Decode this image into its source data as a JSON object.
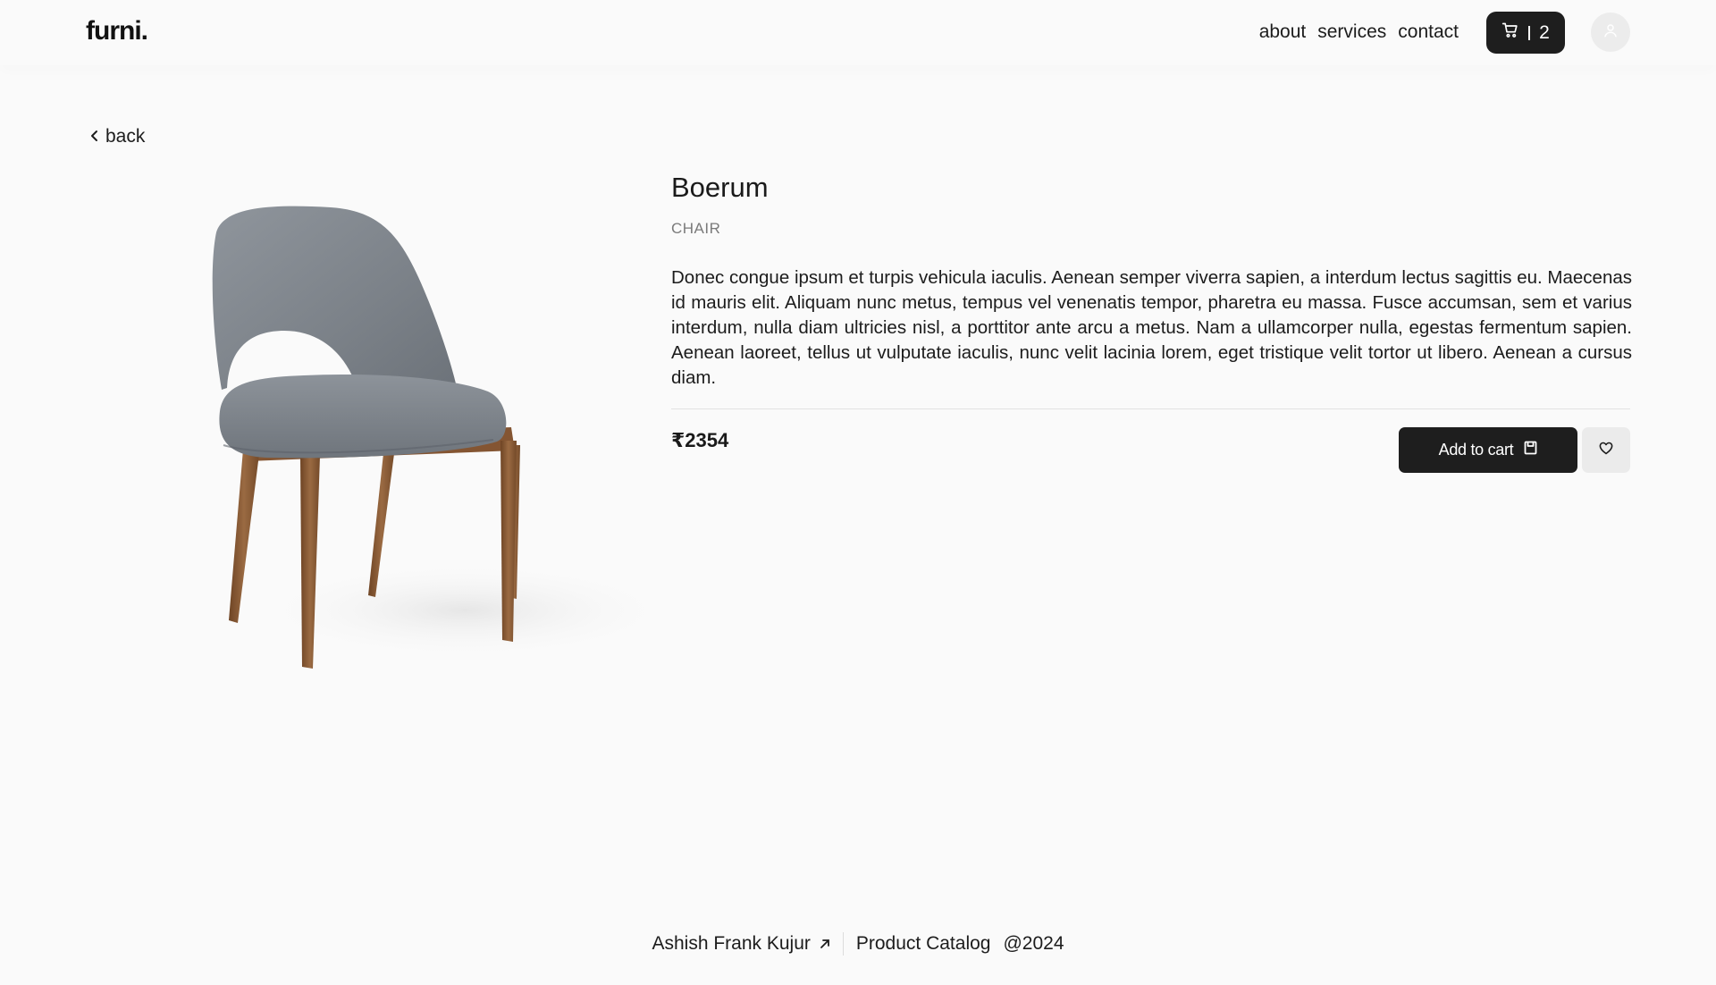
{
  "header": {
    "logo": "furni.",
    "nav": [
      "about",
      "services",
      "contact"
    ],
    "cart_count": "2"
  },
  "back_label": "back",
  "product": {
    "name": "Boerum",
    "category": "CHAIR",
    "description": "Donec congue ipsum et turpis vehicula iaculis. Aenean semper viverra sapien, a interdum lectus sagittis eu. Maecenas id mauris elit. Aliquam nunc metus, tempus vel venenatis tempor, pharetra eu massa. Fusce accumsan, sem et varius interdum, nulla diam ultricies nisl, a porttitor ante arcu a metus. Nam a ullamcorper nulla, egestas fermentum sapien. Aenean laoreet, tellus ut vulputate iaculis, nunc velit lacinia lorem, eget tristique velit tortor ut libero. Aenean a cursus diam.",
    "price": "₹2354",
    "add_to_cart_label": "Add to cart"
  },
  "footer": {
    "author": "Ashish Frank Kujur",
    "catalog": "Product Catalog",
    "year": "@2024"
  },
  "colors": {
    "background": "#fafafa",
    "primary_button": "#1e1e1e",
    "secondary_button": "#ebebeb",
    "chair_upholstery": "#7f858c",
    "chair_wood": "#8a5a34"
  },
  "icons": [
    "cart-icon",
    "user-icon",
    "chevron-left-icon",
    "save-icon",
    "heart-icon",
    "arrow-up-right-icon"
  ]
}
